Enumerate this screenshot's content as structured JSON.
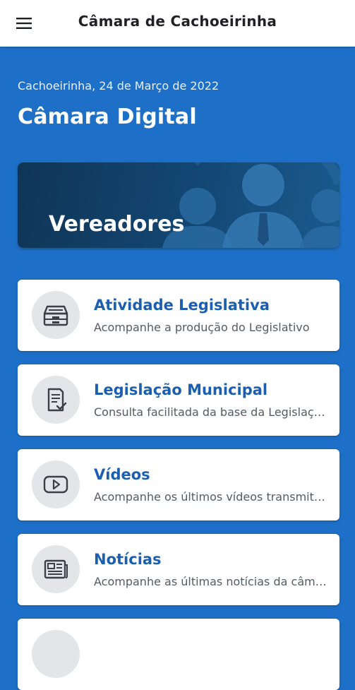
{
  "appbar": {
    "title": "Câmara de Cachoeirinha"
  },
  "hero": {
    "date": "Cachoeirinha, 24 de Março de 2022",
    "title": "Câmara Digital"
  },
  "banner": {
    "label": "Vereadores"
  },
  "cards": [
    {
      "title": "Atividade Legislativa",
      "subtitle": "Acompanhe a produção do Legislativo",
      "icon": "archive-tray-icon"
    },
    {
      "title": "Legislação Municipal",
      "subtitle": "Consulta facilitada da base da Legislação",
      "icon": "document-check-icon"
    },
    {
      "title": "Vídeos",
      "subtitle": "Acompanhe os últimos vídeos transmitidos",
      "icon": "video-play-icon"
    },
    {
      "title": "Notícias",
      "subtitle": "Acompanhe as últimas notícias da câmara",
      "icon": "newspaper-icon"
    }
  ],
  "colors": {
    "background": "#1E6FC7",
    "card_title": "#1C5FB0",
    "banner": "#134774"
  }
}
